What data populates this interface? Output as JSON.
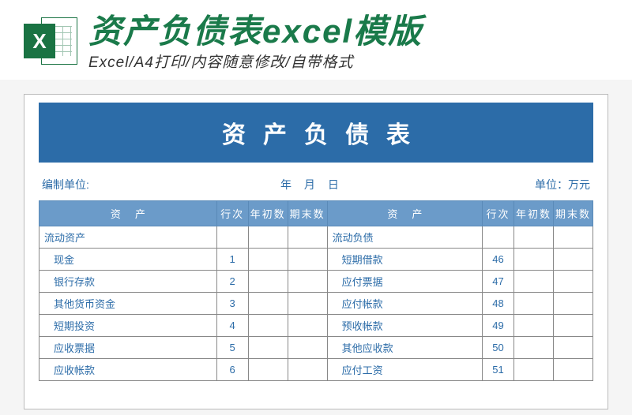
{
  "header": {
    "iconLetter": "X",
    "title": "资产负债表excel模版",
    "subtitle": "Excel/A4打印/内容随意修改/自带格式"
  },
  "sheet": {
    "bannerTitle": "资产负债表",
    "meta": {
      "org": "编制单位:",
      "date": "年 月 日",
      "unit": "单位：万元"
    },
    "columns": {
      "asset": "资产",
      "row": "行次",
      "beginning": "年初数",
      "ending": "期末数"
    },
    "leftSection": "流动资产",
    "rightSection": "流动负债",
    "leftRows": [
      {
        "label": "现金",
        "row": "1"
      },
      {
        "label": "银行存款",
        "row": "2"
      },
      {
        "label": "其他货币资金",
        "row": "3"
      },
      {
        "label": "短期投资",
        "row": "4"
      },
      {
        "label": "应收票据",
        "row": "5"
      },
      {
        "label": "应收帐款",
        "row": "6"
      }
    ],
    "rightRows": [
      {
        "label": "短期借款",
        "row": "46"
      },
      {
        "label": "应付票据",
        "row": "47"
      },
      {
        "label": "应付帐款",
        "row": "48"
      },
      {
        "label": "预收帐款",
        "row": "49"
      },
      {
        "label": "其他应收款",
        "row": "50"
      },
      {
        "label": "应付工资",
        "row": "51"
      }
    ]
  }
}
